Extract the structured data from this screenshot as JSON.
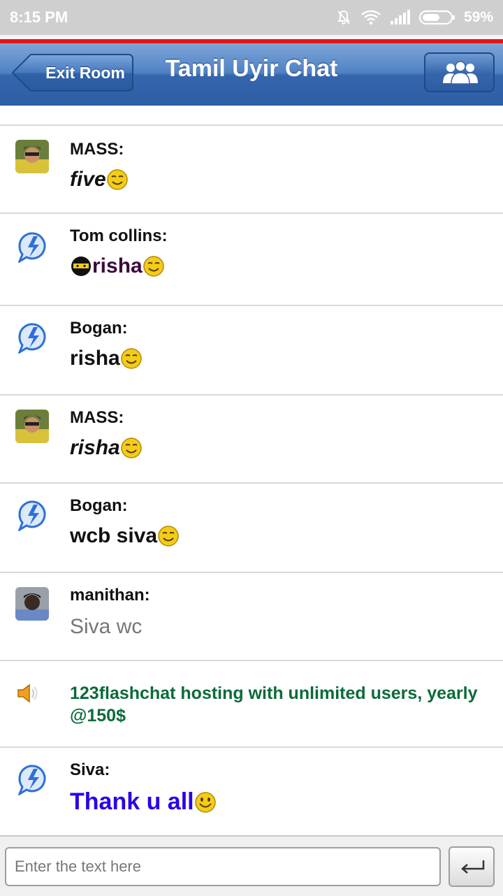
{
  "statusbar": {
    "time": "8:15 PM",
    "battery": "59%"
  },
  "navbar": {
    "back_label": "Exit Room",
    "title": "Tamil Uyir Chat"
  },
  "messages": [
    {
      "sender": "MASS:",
      "text": "five",
      "color": "#111111"
    },
    {
      "sender": "Tom collins:",
      "text": "risha",
      "color": "#3a0a3a"
    },
    {
      "sender": "Bogan:",
      "text": "risha",
      "color": "#111111"
    },
    {
      "sender": "MASS:",
      "text": "risha",
      "color": "#111111"
    },
    {
      "sender": "Bogan:",
      "text": "wcb siva",
      "color": "#111111"
    },
    {
      "sender": "manithan:",
      "text": "Siva wc",
      "color": "#777777"
    },
    {
      "sender": "",
      "text": "123flashchat hosting with unlimited users, yearly @150$",
      "color": "#0b6b3a"
    },
    {
      "sender": "Siva:",
      "text": "Thank u all",
      "color": "#2a00e8"
    }
  ],
  "composer": {
    "placeholder": "Enter the text here"
  }
}
